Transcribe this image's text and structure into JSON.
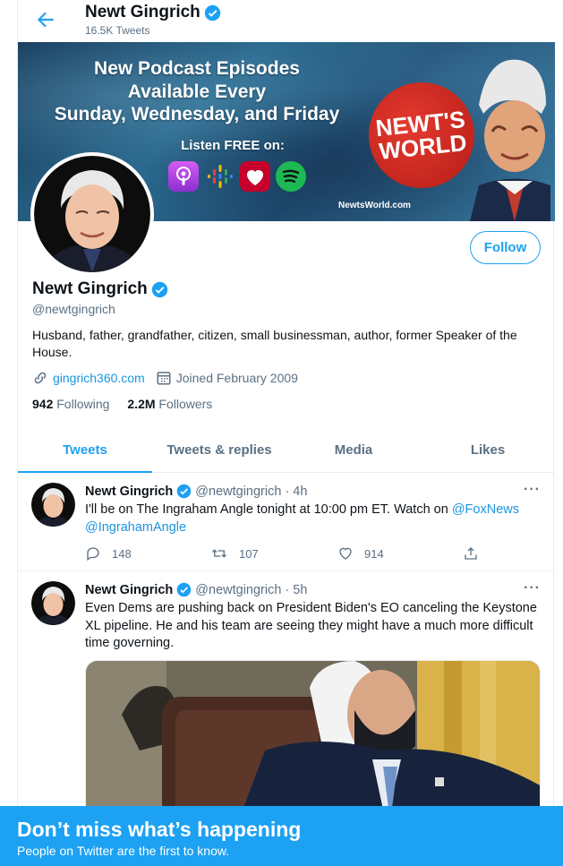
{
  "header": {
    "name": "Newt Gingrich",
    "tweet_count": "16.5K Tweets"
  },
  "banner": {
    "line1": "New Podcast Episodes",
    "line2": "Available Every",
    "line3": "Sunday, Wednesday, and Friday",
    "listen": "Listen FREE on:",
    "logo_line1": "NEWT'S",
    "logo_line2": "WORLD",
    "url": "NewtsWorld.com"
  },
  "profile": {
    "name": "Newt Gingrich",
    "handle": "@newtgingrich",
    "follow_label": "Follow",
    "bio": "Husband, father, grandfather, citizen, small businessman, author, former Speaker of the House.",
    "website": "gingrich360.com",
    "joined": "Joined February 2009",
    "following_count": "942",
    "following_label": "Following",
    "followers_count": "2.2M",
    "followers_label": "Followers"
  },
  "tabs": [
    {
      "label": "Tweets",
      "active": true
    },
    {
      "label": "Tweets & replies",
      "active": false
    },
    {
      "label": "Media",
      "active": false
    },
    {
      "label": "Likes",
      "active": false
    }
  ],
  "tweets": [
    {
      "name": "Newt Gingrich",
      "handle": "@newtgingrich",
      "time": "· 4h",
      "text": "I'll be on The Ingraham Angle tonight at  10:00 pm ET.  Watch on ",
      "mention1": "@FoxNews",
      "mention2": "@IngrahamAngle",
      "replies": "148",
      "retweets": "107",
      "likes": "914"
    },
    {
      "name": "Newt Gingrich",
      "handle": "@newtgingrich",
      "time": "· 5h",
      "text": "Even Dems are pushing back on President Biden's EO canceling the Keystone XL pipeline. He and his team are seeing they might have a much more difficult time governing."
    }
  ],
  "more_glyph": "···",
  "cta": {
    "title": "Don’t miss what’s happening",
    "subtitle": "People on Twitter are the first to know."
  },
  "colors": {
    "accent": "#1da1f2",
    "link": "#1b95e0",
    "muted": "#5b7083"
  }
}
